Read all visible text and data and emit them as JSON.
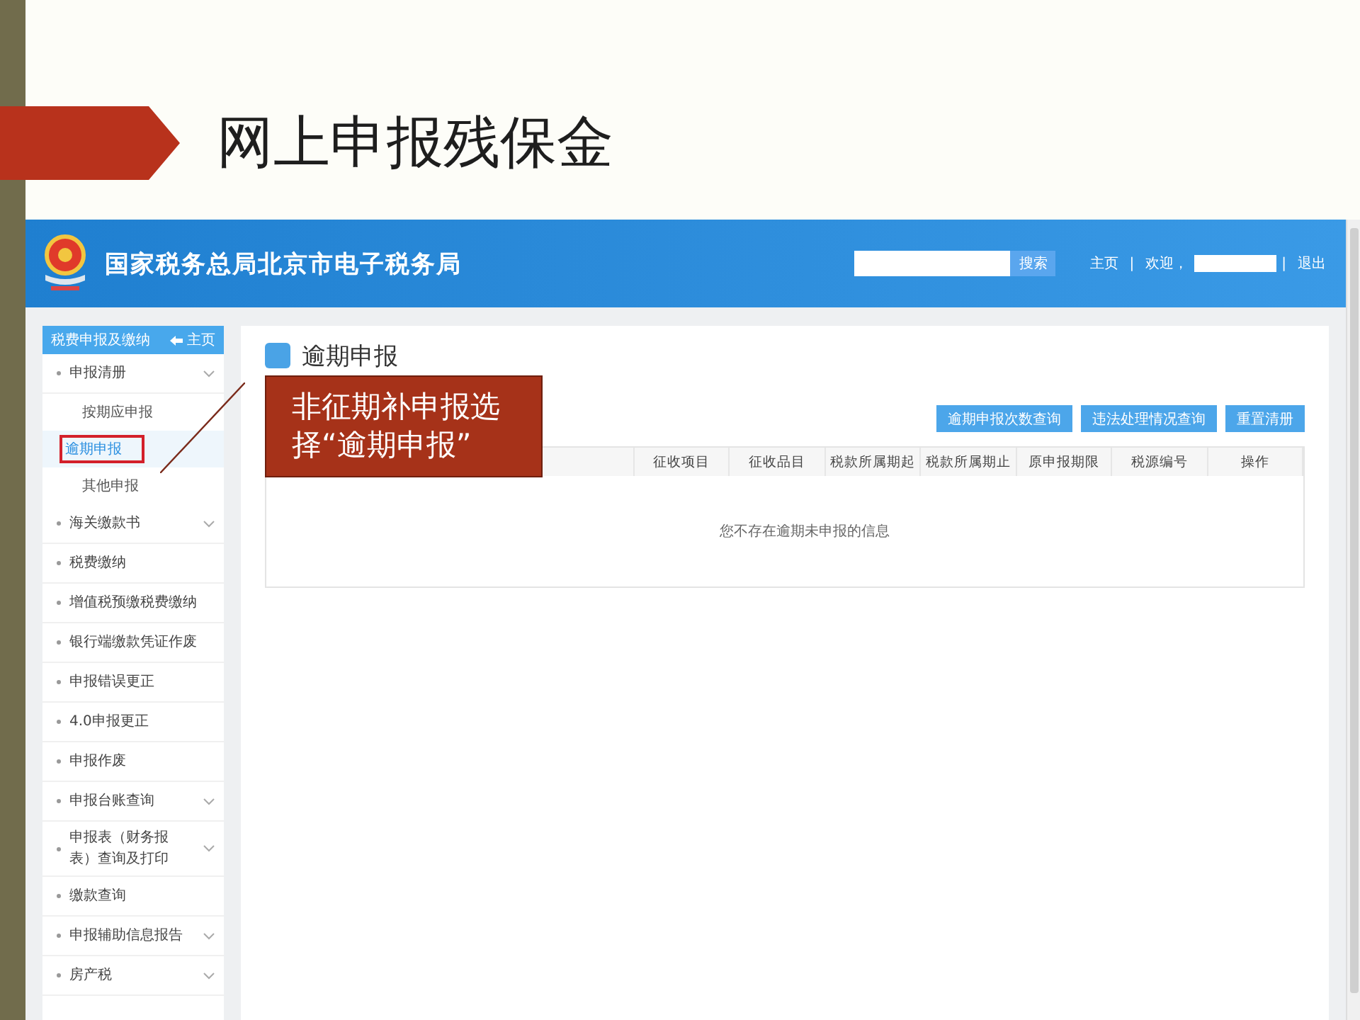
{
  "slide_title": "网上申报残保金",
  "header": {
    "site_title": "国家税务总局北京市电子税务局",
    "search_button": "搜索",
    "links": [
      {
        "kind": "link",
        "text": "主页"
      },
      {
        "kind": "sep",
        "text": "|"
      },
      {
        "kind": "text",
        "text": "欢迎，"
      },
      {
        "kind": "user"
      },
      {
        "kind": "sep",
        "text": "|"
      },
      {
        "kind": "link",
        "text": "退出"
      }
    ]
  },
  "sidebar": {
    "title": "税费申报及缴纳",
    "home": "主页",
    "items": [
      {
        "label": "申报清册",
        "kind": "group",
        "children": [
          {
            "label": "按期应申报",
            "selected": false
          },
          {
            "label": "逾期申报",
            "selected": true
          },
          {
            "label": "其他申报",
            "selected": false
          }
        ]
      },
      {
        "label": "海关缴款书",
        "kind": "group"
      },
      {
        "label": "税费缴纳",
        "kind": "link"
      },
      {
        "label": "增值税预缴税费缴纳",
        "kind": "link"
      },
      {
        "label": "银行端缴款凭证作废",
        "kind": "link"
      },
      {
        "label": "申报错误更正",
        "kind": "link"
      },
      {
        "label": "4.0申报更正",
        "kind": "link"
      },
      {
        "label": "申报作废",
        "kind": "link"
      },
      {
        "label": "申报台账查询",
        "kind": "group"
      },
      {
        "label": "申报表（财务报表）查询及打印",
        "kind": "group"
      },
      {
        "label": "缴款查询",
        "kind": "link"
      },
      {
        "label": "申报辅助信息报告",
        "kind": "group"
      },
      {
        "label": "房产税",
        "kind": "group"
      }
    ]
  },
  "content": {
    "heading": "逾期申报",
    "buttons": [
      "逾期申报次数查询",
      "违法处理情况查询",
      "重置清册"
    ],
    "table": {
      "columns": [
        "",
        "征收项目",
        "征收品目",
        "税款所属期起",
        "税款所属期止",
        "原申报期限",
        "税源编号",
        "操作"
      ],
      "empty_message": "您不存在逾期未申报的信息"
    }
  },
  "callout": "非征期补申报选择“逾期申报”"
}
